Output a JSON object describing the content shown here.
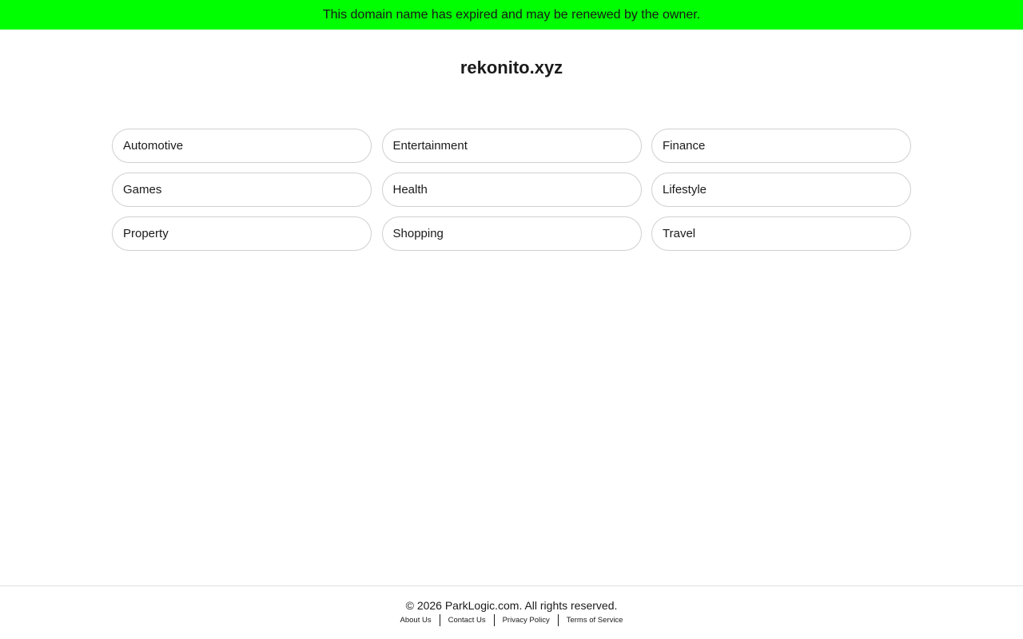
{
  "banner": {
    "message": "This domain name has expired and may be renewed by the owner.",
    "background_color": "#00ff00"
  },
  "domain": {
    "name": "rekonito.xyz"
  },
  "categories": [
    {
      "label": "Automotive"
    },
    {
      "label": "Entertainment"
    },
    {
      "label": "Finance"
    },
    {
      "label": "Games"
    },
    {
      "label": "Health"
    },
    {
      "label": "Lifestyle"
    },
    {
      "label": "Property"
    },
    {
      "label": "Shopping"
    },
    {
      "label": "Travel"
    }
  ],
  "footer": {
    "copyright": "© 2026 ParkLogic.com. All rights reserved.",
    "links": [
      {
        "label": "About Us"
      },
      {
        "label": "Contact Us"
      },
      {
        "label": "Privacy Policy"
      },
      {
        "label": "Terms of Service"
      }
    ]
  }
}
